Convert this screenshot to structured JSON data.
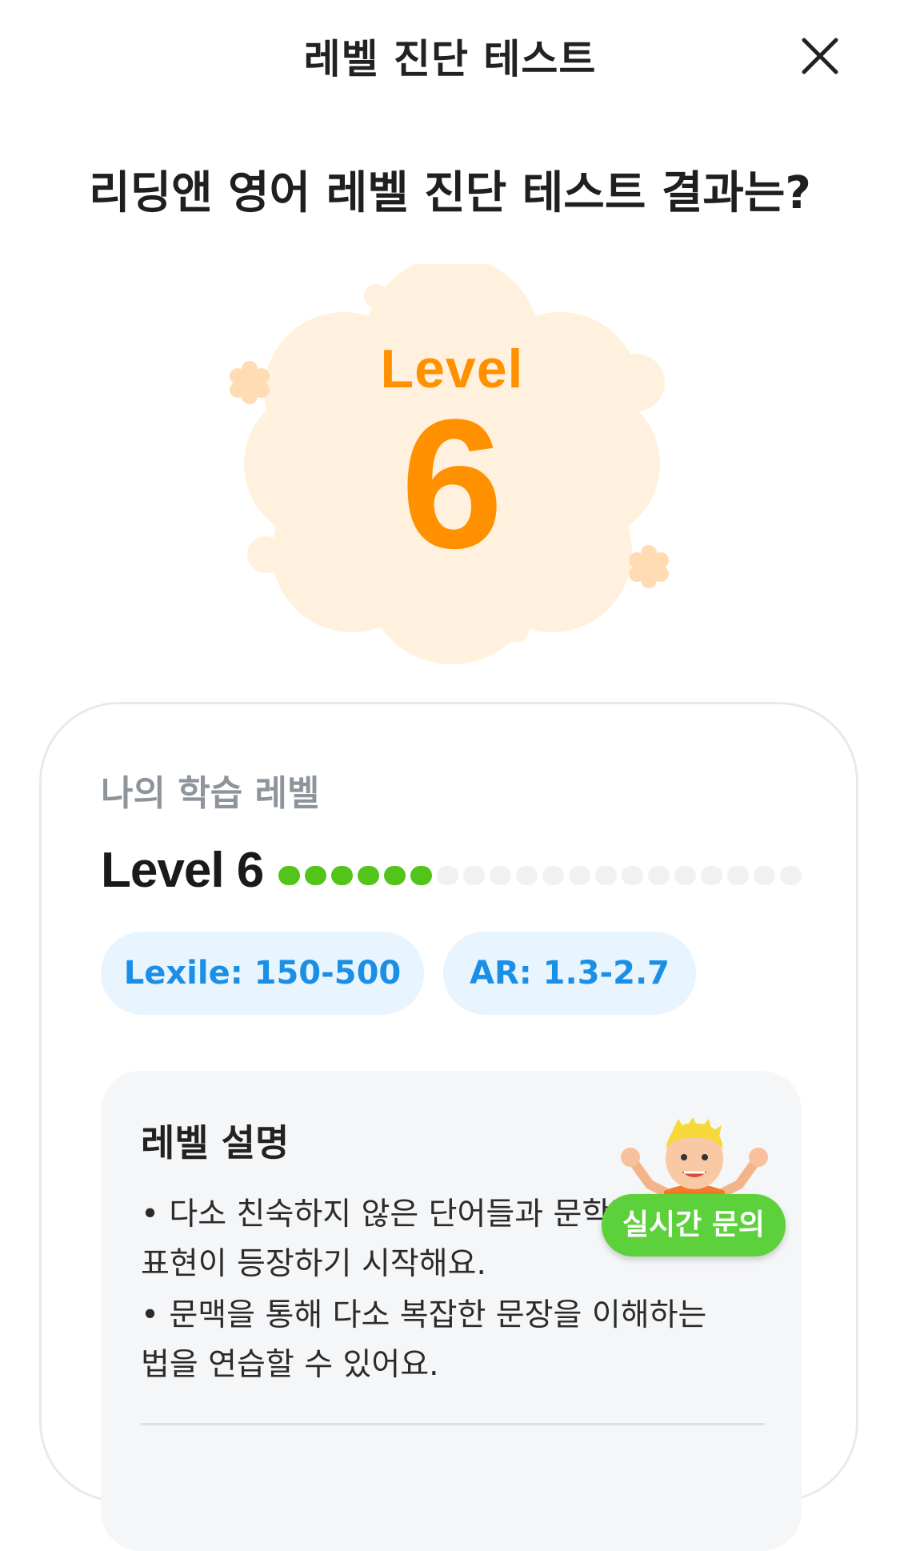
{
  "header": {
    "title": "레벨 진단 테스트"
  },
  "result": {
    "title": "리딩앤 영어 레벨 진단 테스트 결과는?"
  },
  "badge": {
    "level_word": "Level",
    "level_number": "6",
    "color": "#ff9100",
    "cloud_color": "#fff1dd"
  },
  "card": {
    "label": "나의 학습 레벨",
    "level_text": "Level 6",
    "progress": {
      "filled": 6,
      "total": 20,
      "filled_color": "#52c41a",
      "empty_color": "#f0f1f3"
    },
    "chips": {
      "lexile": "Lexile: 150-500",
      "ar": "AR: 1.3-2.7"
    }
  },
  "description": {
    "title": "레벨 설명",
    "lines": [
      "• 다소 친숙하지 않은 단어들과 문학적",
      "표현이 등장하기 시작해요.",
      "• 문맥을 통해 다소 복잡한 문장을 이해하는",
      "법을 연습할 수 있어요."
    ]
  },
  "live_chat": {
    "label": "실시간 문의",
    "color": "#5cd13c"
  }
}
